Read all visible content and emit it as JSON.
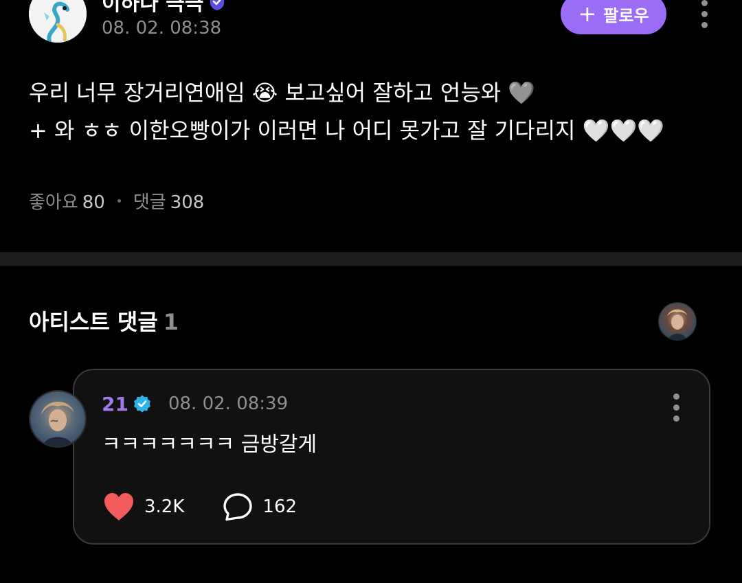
{
  "post": {
    "author": {
      "name": "이하나 극극",
      "avatar_icon": "dragon-fish-avatar-icon",
      "badge_icon": "verified-badge-icon"
    },
    "timestamp": "08. 02. 08:38",
    "follow_button": {
      "label": "팔로우",
      "icon": "plus-icon",
      "color": "#9b6cf5"
    },
    "body_lines": [
      "우리 너무 장거리연애임 😭 보고싶어 잘하고 언능와 🩶",
      "+ 와 ㅎㅎ 이한오빵이가 이러면 나 어디 못가고 잘 기다리지 🤍🤍🤍"
    ],
    "stats": {
      "likes_label": "좋아요",
      "likes": "80",
      "comments_label": "댓글",
      "comments": "308"
    }
  },
  "artist_comments": {
    "title": "아티스트 댓글",
    "count": "1",
    "comment": {
      "author": "21",
      "author_color": "#9f7aea",
      "timestamp": "08. 02. 08:39",
      "text": "ㅋㅋㅋㅋㅋㅋㅋ 금방갈게",
      "likes": "3.2K",
      "replies": "162",
      "like_icon": "heart-icon",
      "reply_icon": "speech-bubble-icon",
      "like_color": "#f25b5b"
    }
  }
}
